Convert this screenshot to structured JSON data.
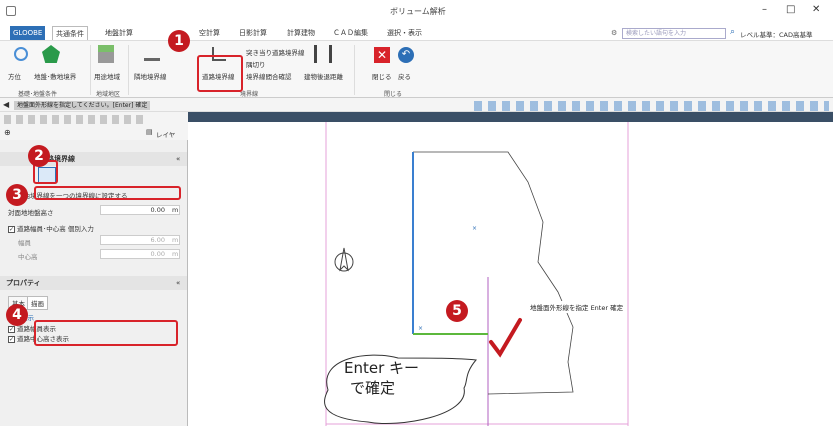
{
  "app_title": "ボリューム解析",
  "window_controls": [
    "–",
    "□",
    "✕"
  ],
  "tabs": [
    "GLOOBE",
    "共通条件",
    "地盤計算",
    "空計算",
    "日影計算",
    "計算建物",
    "ＣＡＤ編集",
    "選択・表示"
  ],
  "search": {
    "placeholder": "検索したい語句を入力"
  },
  "level_label": "レベル基準：CAD高基準",
  "ribbon": {
    "btn_direction": "方位",
    "btn_ground": "地盤･敷地境界",
    "btn_usage": "用途地域",
    "btn_adjacent": "隣地境界線",
    "btn_road": "道路境界線",
    "btn_dead_end": "突き当り道路境界線",
    "btn_corner": "隅切り",
    "btn_boundary_check": "境界線間合確認",
    "btn_setback": "建物後退距離",
    "btn_close": "閉じる",
    "btn_back": "戻る",
    "group_base": "基礎･地盤条件",
    "group_zone": "地域地区",
    "group_boundary": "境界線",
    "group_close": "閉じる"
  },
  "prompt": "地盤面外形線を指定してください。[Enter] 確定",
  "layer_label": "レイヤ",
  "panel": {
    "title": "道路境界線",
    "curve_opt": "曲曲境界線を一つの境界線に設定する",
    "opposite_label": "対面地地盤高さ",
    "opposite_value": "0.00",
    "unit": "m",
    "individual_opt": "道路幅員･中心高 個別入力",
    "width_label": "幅員",
    "width_value": "6.00",
    "center_label": "中心高",
    "center_value": "0.00"
  },
  "props": {
    "title": "プロパティ",
    "tab_basic": "基本",
    "tab_draw": "描画",
    "section": "２Ｄ表示",
    "opt_width": "道路幅員表示",
    "opt_center": "道路中心高さ表示"
  },
  "canvas_hint": "地盤面外形線を指定 Enter 確定",
  "callout_line1": "Enter キー",
  "callout_line2": "で確定",
  "steps": [
    "1",
    "2",
    "3",
    "4",
    "5"
  ],
  "colors": {
    "accent": "#2d6fb6",
    "step": "#c41a20",
    "highlight": "#d8232a",
    "outline": "#3a7fd0",
    "road": "#5cb83c",
    "guide": "#e6a0d8"
  }
}
